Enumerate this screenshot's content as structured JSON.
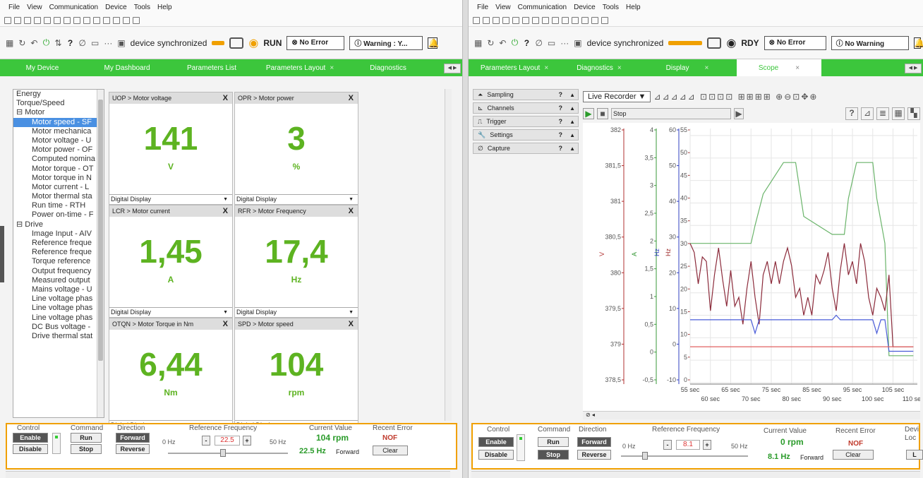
{
  "menu": [
    "File",
    "View",
    "Communication",
    "Device",
    "Tools",
    "Help"
  ],
  "left": {
    "status": {
      "sync": "device synchronized",
      "state": "RUN",
      "error": "⊗ No Error",
      "warning": "ⓘ Warning : Y..."
    },
    "tabs": [
      "My Device",
      "My Dashboard",
      "Parameters List",
      "Parameters Layout",
      "Diagnostics"
    ],
    "tree": [
      "Energy",
      "Torque/Speed",
      "⊟ Motor",
      "Motor speed - SF",
      "Motor mechanica",
      "Motor voltage - U",
      "Motor power - OF",
      "Computed nomina",
      "Motor torque - OT",
      "Motor torque in N",
      "Motor current - L",
      "Motor thermal sta",
      "Run time - RTH",
      "Power on-time - F",
      "⊟ Drive",
      "Image Input - AIV",
      "Reference freque",
      "Reference freque",
      "Torque reference",
      "Output frequency",
      "Measured output",
      "Mains voltage - U",
      "Line voltage phas",
      "Line voltage phas",
      "Line voltage phas",
      "DC Bus voltage -",
      "Drive thermal stat"
    ],
    "cards": [
      {
        "title": "UOP > Motor voltage",
        "value": "141",
        "unit": "V",
        "mode": "Digital Display"
      },
      {
        "title": "OPR > Motor power",
        "value": "3",
        "unit": "%",
        "mode": "Digital Display"
      },
      {
        "title": "LCR > Motor current",
        "value": "1,45",
        "unit": "A",
        "mode": "Digital Display"
      },
      {
        "title": "RFR > Motor Frequency",
        "value": "17,4",
        "unit": "Hz",
        "mode": "Digital Display"
      },
      {
        "title": "OTQN > Motor Torque in Nm",
        "value": "6,44",
        "unit": "Nm",
        "mode": "Digital Display"
      },
      {
        "title": "SPD > Motor speed",
        "value": "104",
        "unit": "rpm",
        "mode": "Digital Display"
      }
    ],
    "ctrl": {
      "control": "Control",
      "command": "Command",
      "direction": "Direction",
      "ref": "Reference Frequency",
      "cur": "Current Value",
      "err": "Recent Error",
      "enable": "Enable",
      "disable": "Disable",
      "run": "Run",
      "stop": "Stop",
      "forward": "Forward",
      "reverse": "Reverse",
      "min": "0 Hz",
      "max": "50 Hz",
      "freq": "22.5",
      "curval": "104 rpm",
      "curfreq": "22.5 Hz",
      "curdir": "Forward",
      "errval": "NOF",
      "clear": "Clear"
    }
  },
  "right": {
    "status": {
      "sync": "device synchronized",
      "state": "RDY",
      "error": "⊗ No Error",
      "warning": "ⓘ No Warning"
    },
    "tabs": [
      "Parameters Layout",
      "Diagnostics",
      "Display",
      "Scope"
    ],
    "side": [
      "Sampling",
      "Channels",
      "Trigger",
      "Settings",
      "Capture"
    ],
    "recorder": "Live Recorder",
    "playstate": "Stop",
    "ctrl": {
      "control": "Control",
      "command": "Command",
      "direction": "Direction",
      "ref": "Reference Frequency",
      "cur": "Current Value",
      "err": "Recent Error",
      "dev": "Devi",
      "loc": "Loc",
      "enable": "Enable",
      "disable": "Disable",
      "run": "Run",
      "stop": "Stop",
      "forward": "Forward",
      "reverse": "Reverse",
      "min": "0 Hz",
      "max": "50 Hz",
      "freq": "8.1",
      "curval": "0 rpm",
      "curfreq": "8.1 Hz",
      "curdir": "Forward",
      "errval": "NOF",
      "clear": "Clear",
      "lbtn": "L"
    }
  },
  "chart_data": {
    "type": "line",
    "x_label": "sec",
    "x_ticks_top": [
      "55 sec",
      "65 sec",
      "75 sec",
      "85 sec",
      "95 sec",
      "105 sec"
    ],
    "x_ticks_bottom": [
      "60 sec",
      "70 sec",
      "80 sec",
      "90 sec",
      "100 sec",
      "110 sec"
    ],
    "axes": [
      {
        "unit": "V",
        "color": "#b03030",
        "ticks": [
          "382",
          "381,5",
          "381",
          "380,5",
          "380",
          "379,5",
          "379",
          "378,5"
        ]
      },
      {
        "unit": "A",
        "color": "#3a9a3a",
        "ticks": [
          "4",
          "3,5",
          "3",
          "2,5",
          "2",
          "1,5",
          "1",
          "0,5",
          "0",
          "-0,5"
        ]
      },
      {
        "unit": "Hz",
        "color": "#3040c0",
        "ticks": [
          "60",
          "50",
          "40",
          "30",
          "20",
          "10",
          "0",
          "-10"
        ]
      },
      {
        "unit": "Hz",
        "color": "#a03030",
        "ticks": [
          "55",
          "50",
          "45",
          "40",
          "35",
          "30",
          "25",
          "20",
          "15",
          "10",
          "5",
          "0"
        ]
      }
    ],
    "series": [
      {
        "color": "#6ab46a",
        "x": [
          55,
          63,
          70,
          71,
          73,
          78,
          80,
          81,
          83,
          90,
          93,
          94,
          96,
          100,
          101,
          103,
          104,
          110
        ],
        "y": [
          31,
          31,
          31,
          35,
          42,
          49,
          49,
          49,
          37,
          33,
          33,
          41,
          49,
          49,
          41,
          31,
          6,
          6
        ]
      },
      {
        "color": "#8b2a3a",
        "x": [
          55,
          56,
          57,
          58,
          59,
          60,
          61,
          62,
          63,
          64,
          65,
          66,
          67,
          68,
          69,
          70,
          71,
          72,
          73,
          74,
          75,
          76,
          77,
          78,
          79,
          80,
          81,
          82,
          83,
          84,
          85,
          86,
          87,
          88,
          89,
          90,
          91,
          92,
          93,
          94,
          95,
          96,
          97,
          98,
          99,
          100,
          101,
          102,
          103,
          104,
          105,
          106,
          107,
          108,
          109,
          110
        ],
        "y": [
          31,
          29,
          22,
          28,
          27,
          16,
          24,
          30,
          23,
          17,
          25,
          17,
          19,
          13,
          21,
          27,
          19,
          13,
          24,
          27,
          22,
          27,
          22,
          27,
          30,
          26,
          19,
          21,
          15,
          19,
          15,
          24,
          22,
          25,
          29,
          21,
          16,
          25,
          31,
          24,
          27,
          22,
          31,
          27,
          19,
          15,
          21,
          19,
          16,
          24,
          8,
          8,
          8,
          8,
          8,
          8
        ]
      },
      {
        "color": "#4a5cd8",
        "x": [
          55,
          70,
          71,
          72,
          90,
          91,
          92,
          100,
          101,
          102,
          103,
          104,
          110
        ],
        "y": [
          14,
          14,
          11,
          14,
          14,
          15,
          14,
          14,
          11,
          14,
          14,
          7,
          7
        ]
      },
      {
        "color": "#e06060",
        "x": [
          55,
          110
        ],
        "y": [
          8,
          8
        ]
      }
    ]
  },
  "colors": {
    "green": "#3cc63c",
    "value": "#5db321",
    "accent": "#f0a000"
  }
}
